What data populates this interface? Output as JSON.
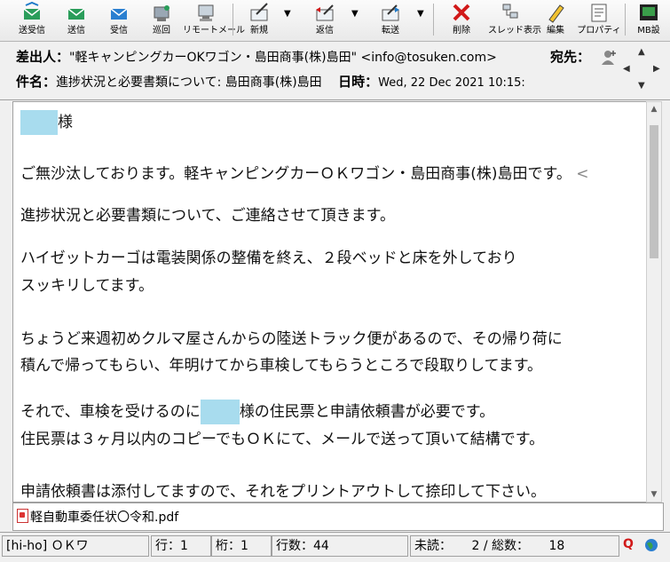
{
  "toolbar": {
    "send_receive": "送受信",
    "send": "送信",
    "receive": "受信",
    "patrol": "巡回",
    "remote_mail": "リモートメール",
    "new": "新規",
    "reply": "返信",
    "forward": "転送",
    "delete": "削除",
    "thread_view": "スレッド表示",
    "edit": "編集",
    "properties": "プロパティ",
    "mb_settings": "MB設"
  },
  "header": {
    "from_label": "差出人：",
    "from_value": "\"軽キャンピングカーOKワゴン・島田商事(株)島田\" <info@tosuken.com>",
    "to_label": "宛先：",
    "subject_label": "件名：",
    "subject_value": "進捗状況と必要書類について: 島田商事(株)島田",
    "date_label": "日時：",
    "date_value": "Wed, 22 Dec 2021 10:15:"
  },
  "message": {
    "line1_suffix": "様",
    "line2": "ご無沙汰しております。軽キャンピングカーＯＫワゴン・島田商事(株)島田です。",
    "line2_tail": "<",
    "line3": "進捗状況と必要書類について、ご連絡させて頂きます。",
    "line4": "ハイゼットカーゴは電装関係の整備を終え、２段ベッドと床を外しており",
    "line5": "スッキリしてます。",
    "line6": "ちょうど来週初めクルマ屋さんからの陸送トラック便があるので、その帰り荷に",
    "line7": "積んで帰ってもらい、年明けてから車検してもらうところで段取りしてます。",
    "line8_prefix": "それで、車検を受けるのに",
    "line8_suffix": "様の住民票と申請依頼書が必要です。",
    "line9": "住民票は３ヶ月以内のコピーでもＯＫにて、メールで送って頂いて結構です。",
    "line10": "申請依頼書は添付してますので、それをプリントアウトして捺印して下さい。"
  },
  "attachment": {
    "filename": "軽自動車委任状〇令和.pdf"
  },
  "status": {
    "account": "[hi-ho] ＯＫワ",
    "row": "行：1",
    "col": "桁：1",
    "lines": "行数：44",
    "unread_label": "未読：",
    "unread": "2",
    "slash_total_label": "/ 総数：",
    "total": "18",
    "q_icon": "Q"
  },
  "colors": {
    "redaction": "#a8dcee",
    "delete_x": "#d11a1a",
    "pdf_red": "#cc3333"
  }
}
